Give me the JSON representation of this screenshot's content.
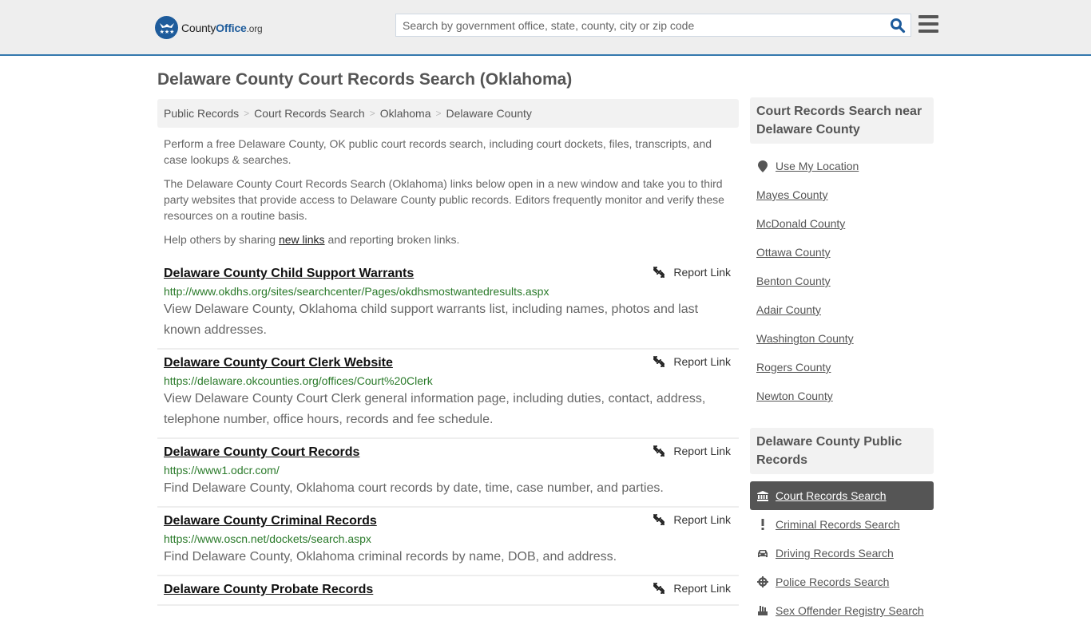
{
  "header": {
    "logo": {
      "brand_a": "County",
      "brand_b": "Office",
      "brand_c": ".org"
    },
    "search": {
      "placeholder": "Search by government office, state, county, city or zip code",
      "value": ""
    },
    "icons": {
      "search": "search-icon",
      "menu": "hamburger-menu-icon"
    },
    "accent_color": "#3478ae"
  },
  "page": {
    "title": "Delaware County Court Records Search (Oklahoma)",
    "breadcrumb": [
      "Public Records",
      "Court Records Search",
      "Oklahoma",
      "Delaware County"
    ],
    "breadcrumb_separator": ">",
    "intro": {
      "p1": "Perform a free Delaware County, OK public court records search, including court dockets, files, transcripts, and case lookups & searches.",
      "p2": "The Delaware County Court Records Search (Oklahoma) links below open in a new window and take you to third party websites that provide access to Delaware County public records. Editors frequently monitor and verify these resources on a routine basis.",
      "p3_before": "Help others by sharing ",
      "p3_link": "new links",
      "p3_after": " and reporting broken links."
    },
    "report_label": "Report Link",
    "results": [
      {
        "title": "Delaware County Child Support Warrants",
        "url": "http://www.okdhs.org/sites/searchcenter/Pages/okdhsmostwantedresults.aspx",
        "desc": "View Delaware County, Oklahoma child support warrants list, including names, photos and last known addresses."
      },
      {
        "title": "Delaware County Court Clerk Website",
        "url": "https://delaware.okcounties.org/offices/Court%20Clerk",
        "desc": "View Delaware County Court Clerk general information page, including duties, contact, address, telephone number, office hours, records and fee schedule."
      },
      {
        "title": "Delaware County Court Records",
        "url": "https://www1.odcr.com/",
        "desc": "Find Delaware County, Oklahoma court records by date, time, case number, and parties."
      },
      {
        "title": "Delaware County Criminal Records",
        "url": "https://www.oscn.net/dockets/search.aspx",
        "desc": "Find Delaware County, Oklahoma criminal records by name, DOB, and address."
      },
      {
        "title": "Delaware County Probate Records",
        "url": "",
        "desc": ""
      }
    ]
  },
  "sidebar": {
    "nearby": {
      "heading": "Court Records Search near Delaware County",
      "use_location": "Use My Location",
      "counties": [
        "Mayes County",
        "McDonald County",
        "Ottawa County",
        "Benton County",
        "Adair County",
        "Washington County",
        "Rogers County",
        "Newton County"
      ]
    },
    "public_records": {
      "heading": "Delaware County Public Records",
      "items": [
        {
          "label": "Court Records Search",
          "icon": "courthouse-icon",
          "active": true
        },
        {
          "label": "Criminal Records Search",
          "icon": "exclamation-icon",
          "active": false
        },
        {
          "label": "Driving Records Search",
          "icon": "car-icon",
          "active": false
        },
        {
          "label": "Police Records Search",
          "icon": "crosshair-icon",
          "active": false
        },
        {
          "label": "Sex Offender Registry Search",
          "icon": "fist-icon",
          "active": false
        }
      ]
    }
  }
}
